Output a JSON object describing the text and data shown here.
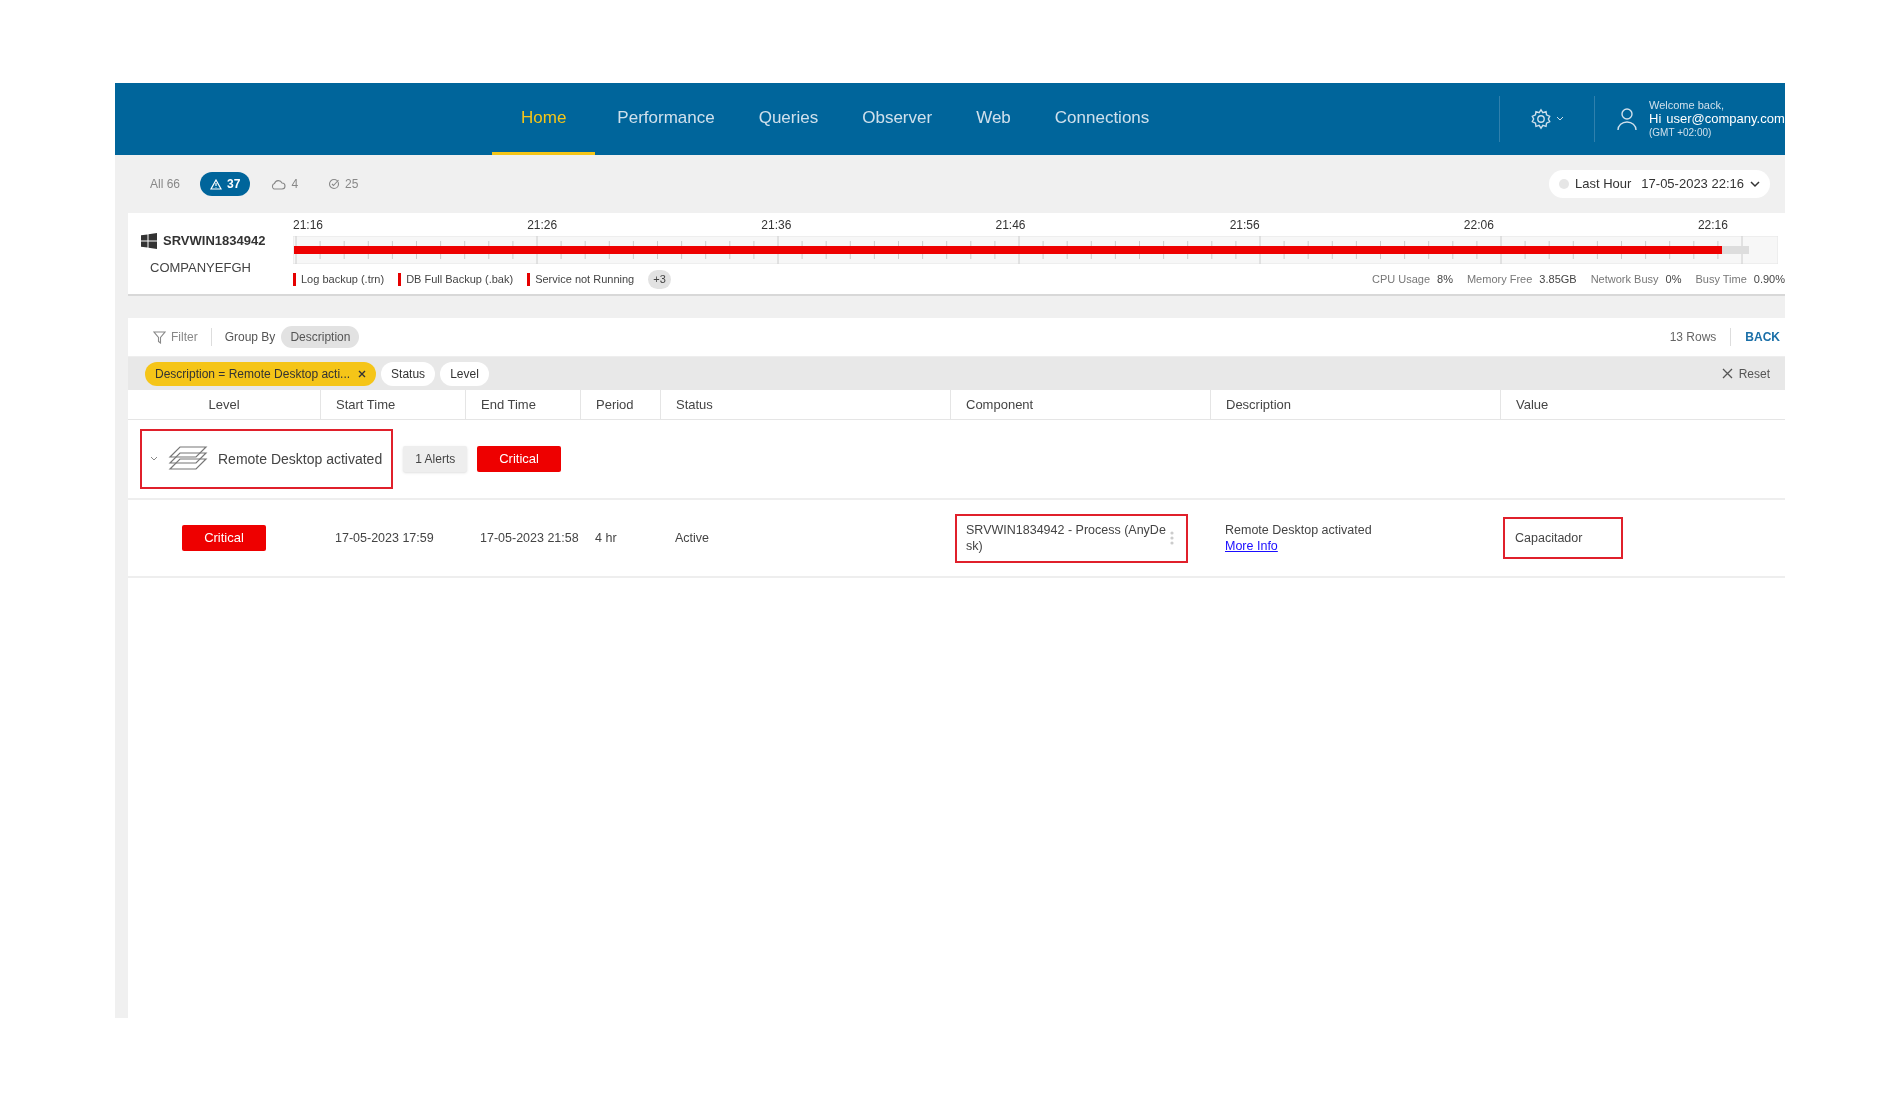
{
  "nav": {
    "items": [
      {
        "label": "Home",
        "selected": true
      },
      {
        "label": "Performance",
        "selected": false
      },
      {
        "label": "Queries",
        "selected": false
      },
      {
        "label": "Observer",
        "selected": false
      },
      {
        "label": "Web",
        "selected": false
      },
      {
        "label": "Connections",
        "selected": false
      }
    ]
  },
  "user": {
    "greeting": "Welcome back,",
    "hi": "Hi",
    "email": "user@company.com",
    "timezone": "(GMT +02:00)"
  },
  "stats": [
    {
      "kind": "all",
      "label": "All 66",
      "selected": false
    },
    {
      "kind": "alert",
      "label": "37",
      "selected": true
    },
    {
      "kind": "cloud",
      "label": "4",
      "selected": false
    },
    {
      "kind": "check",
      "label": "25",
      "selected": false
    }
  ],
  "time_range": {
    "label": "Last Hour",
    "value": "17-05-2023 22:16"
  },
  "server": {
    "name": "SRVWIN1834942",
    "company": "COMPANYEFGH",
    "ticks": [
      "21:16",
      "21:26",
      "21:36",
      "21:46",
      "21:56",
      "22:06",
      "22:16"
    ],
    "legend": [
      {
        "label": "Log backup (.trn)",
        "color": "#e50000"
      },
      {
        "label": "DB Full Backup (.bak)",
        "color": "#e50000"
      },
      {
        "label": "Service not Running",
        "color": "#e50000"
      }
    ],
    "more": "+3",
    "metrics": [
      {
        "label": "CPU Usage",
        "value": "8%"
      },
      {
        "label": "Memory Free",
        "value": "3.85GB"
      },
      {
        "label": "Network Busy",
        "value": "0%"
      },
      {
        "label": "Busy Time",
        "value": "0.90%"
      }
    ]
  },
  "toolbar": {
    "filter": "Filter",
    "group_by_label": "Group By",
    "group_by_value": "Description",
    "rows": "13 Rows",
    "back": "BACK"
  },
  "chips": [
    {
      "kind": "active",
      "label": "Description = Remote Desktop acti..."
    },
    {
      "kind": "plain",
      "label": "Status"
    },
    {
      "kind": "plain",
      "label": "Level"
    }
  ],
  "reset": "Reset",
  "table": {
    "columns": [
      "Level",
      "Start Time",
      "End Time",
      "Period",
      "Status",
      "Component",
      "Description",
      "Value"
    ],
    "group": {
      "expanded": true,
      "highlighted": true,
      "title": "Remote Desktop activated",
      "alerts": "1 Alerts",
      "level": "Critical"
    },
    "rows": [
      {
        "level": "Critical",
        "start": "17-05-2023 17:59",
        "end": "17-05-2023 21:58",
        "period": "4 hr",
        "status": "Active",
        "component": "SRVWIN1834942 - Process (AnyDesk)",
        "component_highlighted": true,
        "description": "Remote Desktop activated",
        "link": "More Info",
        "value": "Capacitador",
        "value_highlighted": true
      }
    ]
  }
}
